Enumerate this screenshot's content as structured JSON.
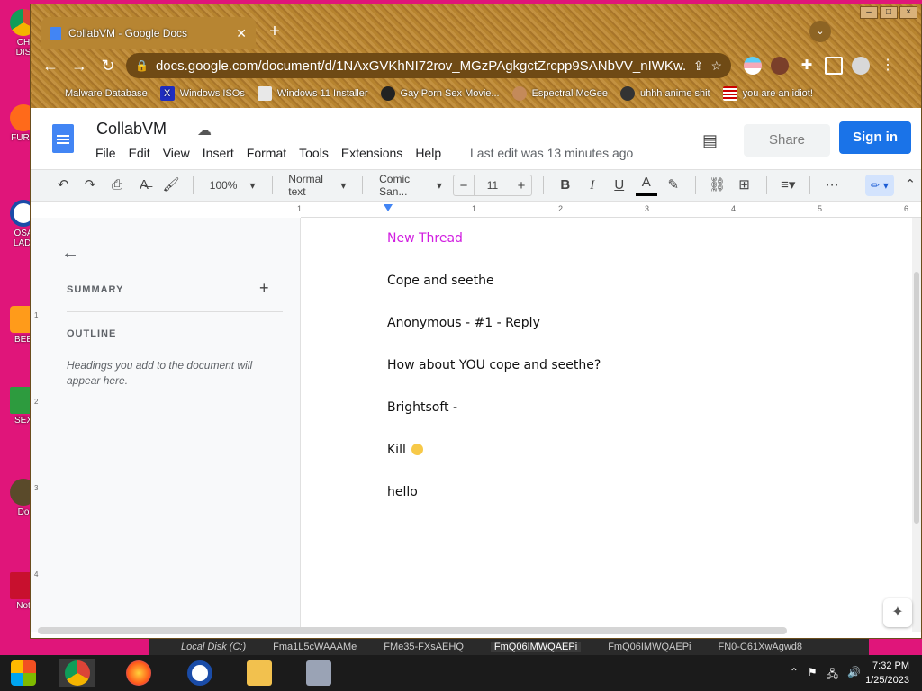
{
  "desktop": {
    "icons": [
      {
        "label": "CH",
        "sub": "DIS"
      },
      {
        "label": "FURR",
        "sub": ""
      },
      {
        "label": "OSA",
        "sub": "LADI"
      },
      {
        "label": "BEE",
        "sub": ""
      },
      {
        "label": "SEX",
        "sub": ""
      },
      {
        "label": "Do",
        "sub": ""
      },
      {
        "label": "Not",
        "sub": ""
      }
    ]
  },
  "browser": {
    "tab_title": "CollabVM - Google Docs",
    "url": "docs.google.com/document/d/1NAxGVKhNI72rov_MGzPAgkgctZrcpp9SANbVV_nIWKw...",
    "bookmarks": [
      "Malware Database",
      "Windows ISOs",
      "Windows 11 Installer",
      "Gay Porn Sex Movie...",
      "Espectral McGee",
      "uhhh anime shit",
      "you are an idiot!"
    ],
    "colors": {
      "frame": "#b7842f",
      "omnibox": "#6f4a15"
    }
  },
  "docs": {
    "title": "CollabVM",
    "menu": [
      "File",
      "Edit",
      "View",
      "Insert",
      "Format",
      "Tools",
      "Extensions",
      "Help"
    ],
    "last_edit": "Last edit was 13 minutes ago",
    "share_label": "Share",
    "signin_label": "Sign in",
    "accent": "#1a73e8"
  },
  "toolbar": {
    "zoom": "100%",
    "style": "Normal text",
    "font": "Comic San...",
    "size": "11"
  },
  "ruler": {
    "ticks": [
      "1",
      "1",
      "2",
      "3",
      "4",
      "5",
      "6"
    ]
  },
  "vruler": {
    "ticks": [
      "1",
      "2",
      "3",
      "4"
    ]
  },
  "outline": {
    "summary_label": "SUMMARY",
    "outline_label": "OUTLINE",
    "hint": "Headings you add to the document will appear here."
  },
  "document": {
    "lines": [
      "New Thread",
      "Cope and seethe",
      "Anonymous - #1 - Reply",
      "How about YOU cope and seethe?",
      "Brightsoft -",
      "Kill",
      "hello"
    ],
    "link_color": "#d11de0"
  },
  "strip": {
    "items": [
      "Local Disk (C:)",
      "Fma1L5cWAAAMe",
      "FMe35-FXsAEHQ",
      "FmQ06IMWQAEPi",
      "FmQ06IMWQAEPi",
      "FN0-C61XwAgwd8"
    ]
  },
  "taskbar": {
    "time": "7:32 PM",
    "date": "1/25/2023"
  }
}
